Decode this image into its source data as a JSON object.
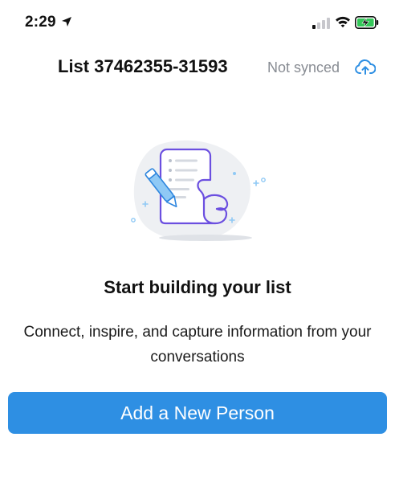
{
  "status_bar": {
    "time": "2:29",
    "icons": [
      "location-arrow-icon",
      "cellular-signal-icon",
      "wifi-icon",
      "battery-charging-icon"
    ]
  },
  "header": {
    "title": "List 37462355-31593",
    "sync_status": "Not synced",
    "sync_icon": "cloud-upload-icon"
  },
  "empty_state": {
    "illustration": "document-scroll-with-pen-illustration",
    "title": "Start building your list",
    "description": "Connect, inspire, and capture information from your conversations"
  },
  "primary_action": {
    "label": "Add a New Person"
  },
  "colors": {
    "accent": "#2e8fe3",
    "muted_text": "#888c93",
    "battery_green": "#34c759",
    "illustration_purple": "#6b4fe0"
  }
}
